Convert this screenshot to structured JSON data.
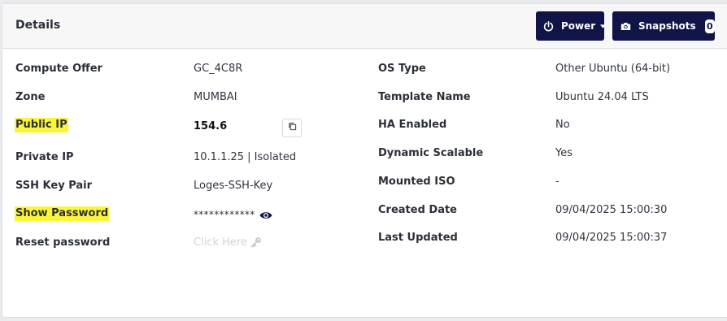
{
  "header": {
    "title": "Details",
    "power_label": "Power",
    "snapshots_label": "Snapshots",
    "snapshots_count": "0"
  },
  "left": [
    {
      "label": "Compute Offer",
      "value": "GC_4C8R"
    },
    {
      "label": "Zone",
      "value": "MUMBAI"
    },
    {
      "label": "Public IP",
      "value": "154.6"
    },
    {
      "label": "Private IP",
      "value": "10.1.1.25 | Isolated"
    },
    {
      "label": "SSH Key Pair",
      "value": "Loges-SSH-Key"
    },
    {
      "label": "Show Password",
      "value": "************"
    },
    {
      "label": "Reset password",
      "value": "Click Here"
    }
  ],
  "right": [
    {
      "label": "OS Type",
      "value": "Other Ubuntu (64-bit)"
    },
    {
      "label": "Template Name",
      "value": "Ubuntu 24.04 LTS"
    },
    {
      "label": "HA Enabled",
      "value": "No"
    },
    {
      "label": "Dynamic Scalable",
      "value": "Yes"
    },
    {
      "label": "Mounted ISO",
      "value": "-"
    },
    {
      "label": "Created Date",
      "value": "09/04/2025 15:00:30"
    },
    {
      "label": "Last Updated",
      "value": "09/04/2025 15:00:37"
    }
  ],
  "colors": {
    "button_bg": "#101446",
    "highlight": "#fbf53a",
    "disabled_link": "#d0d3d8"
  },
  "icons": {
    "power": "power-icon",
    "caret": "caret-down-icon",
    "snapshot": "camera-icon",
    "copy": "copy-icon",
    "reveal": "eye-icon",
    "reset": "key-icon"
  }
}
